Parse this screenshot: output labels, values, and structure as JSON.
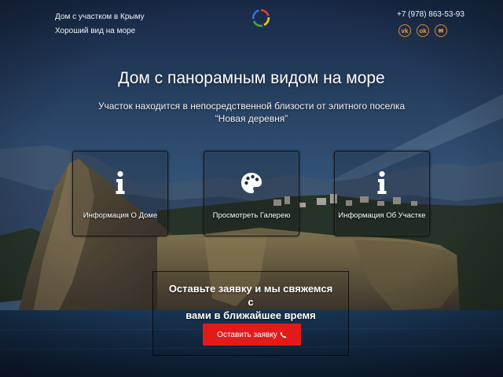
{
  "header": {
    "tagline_line1": "Дом с участком в Крыму",
    "tagline_line2": "Хороший вид на море",
    "phone": "+7 (978) 863-53-93",
    "socials": [
      {
        "icon": "vk-icon",
        "glyph": "vk"
      },
      {
        "icon": "odnoklassniki-icon",
        "glyph": "ok"
      },
      {
        "icon": "email-icon",
        "glyph": "✉"
      }
    ]
  },
  "hero": {
    "title": "Дом с панорамным видом на море",
    "subtitle_line1": "Участок находится в непосредственной близости от элитного поселка",
    "subtitle_line2": "“Новая деревня”"
  },
  "cards": [
    {
      "label": "Информация О Доме",
      "icon": "info-icon"
    },
    {
      "label": "Просмотреть Галерею",
      "icon": "palette-icon"
    },
    {
      "label": "Информация Об Участке",
      "icon": "info-icon"
    }
  ],
  "cta": {
    "line1": "Оставьте заявку и мы свяжемся с",
    "line2": "вами в ближайшее время",
    "button_label": "Оставить заявку",
    "button_icon": "phone-icon"
  },
  "colors": {
    "accent_red": "#e31a1a",
    "social_orange": "#e58a2a",
    "sky_top": "#1c3050",
    "sea": "#16314e"
  }
}
